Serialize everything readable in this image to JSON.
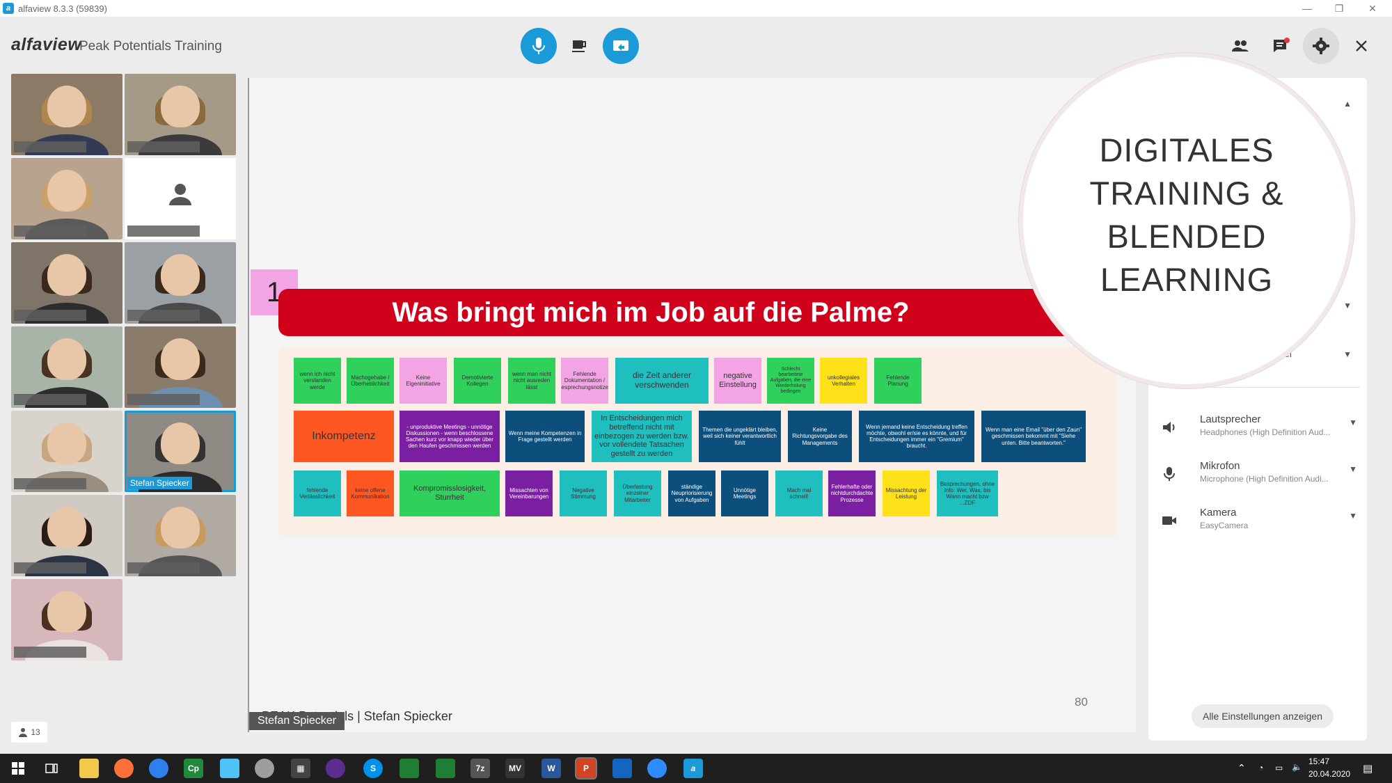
{
  "window": {
    "title": "alfaview 8.3.3 (59839)",
    "app_letter": "a"
  },
  "header": {
    "brand": "alfaview",
    "room": "Peak Potentials Training"
  },
  "gallery": {
    "tiles": [
      {
        "name": ""
      },
      {
        "name": ""
      },
      {
        "name": ""
      },
      {
        "name": ""
      },
      {
        "name": ""
      },
      {
        "name": ""
      },
      {
        "name": ""
      },
      {
        "name": ""
      },
      {
        "name": ""
      },
      {
        "name": "Stefan Spiecker"
      },
      {
        "name": ""
      },
      {
        "name": ""
      },
      {
        "name": ""
      }
    ],
    "participant_count": "13"
  },
  "slide": {
    "number": "1",
    "title": "Was bringt mich im Job auf die Palme?",
    "footer": "PEAK Potentials | Stefan Spiecker",
    "page": "80",
    "presenter": "Stefan Spiecker",
    "notes_row1": [
      "wenn ich nicht verstanden werde",
      "Machogehabe / Überheblichkeit",
      "Keine Eigeninitiative",
      "Demotivierte Kollegen",
      "wenn man nicht nicht ausreden lässt",
      "Fehlende Dokumentation / Besprechungsnotizen",
      "die Zeit anderer verschwenden",
      "negative Einstellung",
      "Schlecht bearbeitete Aufgaben, die eine Wiederholung bedingen",
      "unkollegiales Verhalten",
      "Fehlende Planung"
    ],
    "notes_row2": [
      "Inkompetenz",
      "- unproduktive Meetings - unnötige Diskussionen - wenn beschlossene Sachen kurz vor knapp wieder über den Haufen geschmissen werden",
      "Wenn meine Kompetenzen in Frage gestellt werden",
      "In Entscheidungen mich betreffend nicht mit einbezogen zu werden bzw. vor vollendete Tatsachen gestellt zu werden",
      "Themen die ungeklärt bleiben, weil sich keiner verantwortlich fühlt",
      "Keine Richtungsvorgabe des Managements",
      "Wenn jemand keine Entscheidung treffen möchte, obwohl er/sie es könnte, und für Entscheidungen immer ein \"Gremium\" braucht.",
      "Wenn man eine Email \"über den Zaun\" geschmissen bekommt mit \"Siehe unten. Bitte beantworten.\""
    ],
    "notes_row3": [
      "fehlende Verlässlichkeit",
      "keine offene Kommunikation",
      "Kompromisslosigkeit, Sturrheit",
      "Missachten von Vereinbarungen",
      "Negative Stimmung",
      "Überlastung einzelner Mitarbeiter",
      "ständige Neupriorisierung von Aufgaben",
      "Unnötige Meetings",
      "Mach mal schnell!",
      "Fehlerhafte oder nichtdurchdachte Prozesse",
      "Missachtung der Leistung",
      "Besprechungen, ohne Info: Wer, Was, bis Wann macht bzw ...ZDF"
    ]
  },
  "overlay": {
    "lines": [
      "DIGITALES",
      "TRAINING &",
      "BLENDED",
      "LEARNING"
    ]
  },
  "settings": {
    "partial_label": "...pegel",
    "rows": [
      {
        "label": "Lautsprecher",
        "value": "Headphones (High Definition Aud..."
      },
      {
        "label": "Mikrofon",
        "value": "Microphone (High Definition Audi..."
      },
      {
        "label": "Kamera",
        "value": "EasyCamera"
      }
    ],
    "all_button": "Alle Einstellungen anzeigen"
  },
  "taskbar": {
    "time": "15:47",
    "date": "20.04.2020"
  },
  "colors": {
    "accent": "#1a9ad6",
    "banner": "#d0021b"
  }
}
